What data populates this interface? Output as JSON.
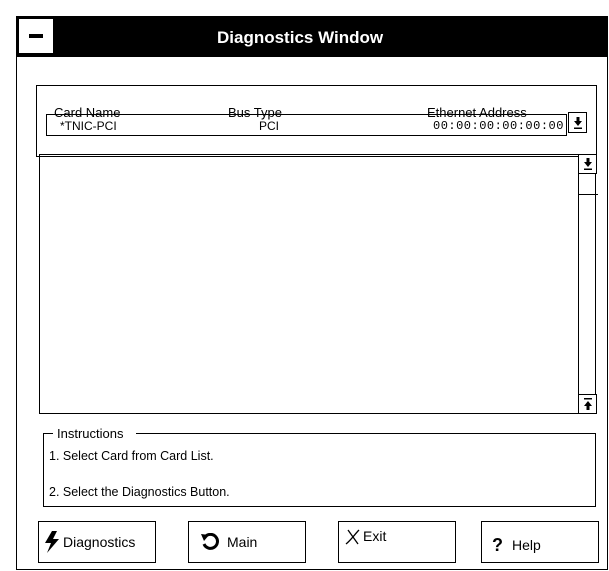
{
  "window": {
    "title": "Diagnostics Window"
  },
  "card_list": {
    "columns": [
      "Card Name",
      "Bus Type",
      "Ethernet Address"
    ],
    "selected": {
      "card_name": "*TNIC-PCI",
      "bus_type": "PCI",
      "ethernet_address": "00:00:00:00:00:00"
    },
    "dropdown_icon": "arrow-down-to-line-icon"
  },
  "results": {
    "scroll_up_icon": "arrow-down-to-line-icon",
    "scroll_down_icon": "arrow-up-to-line-icon"
  },
  "instructions": {
    "legend": "Instructions",
    "lines": [
      "1.  Select Card from Card List.",
      "2.  Select the Diagnostics Button."
    ]
  },
  "buttons": {
    "diagnostics": "Diagnostics",
    "main": "Main",
    "exit": "Exit",
    "help": "Help",
    "help_icon": "?"
  }
}
